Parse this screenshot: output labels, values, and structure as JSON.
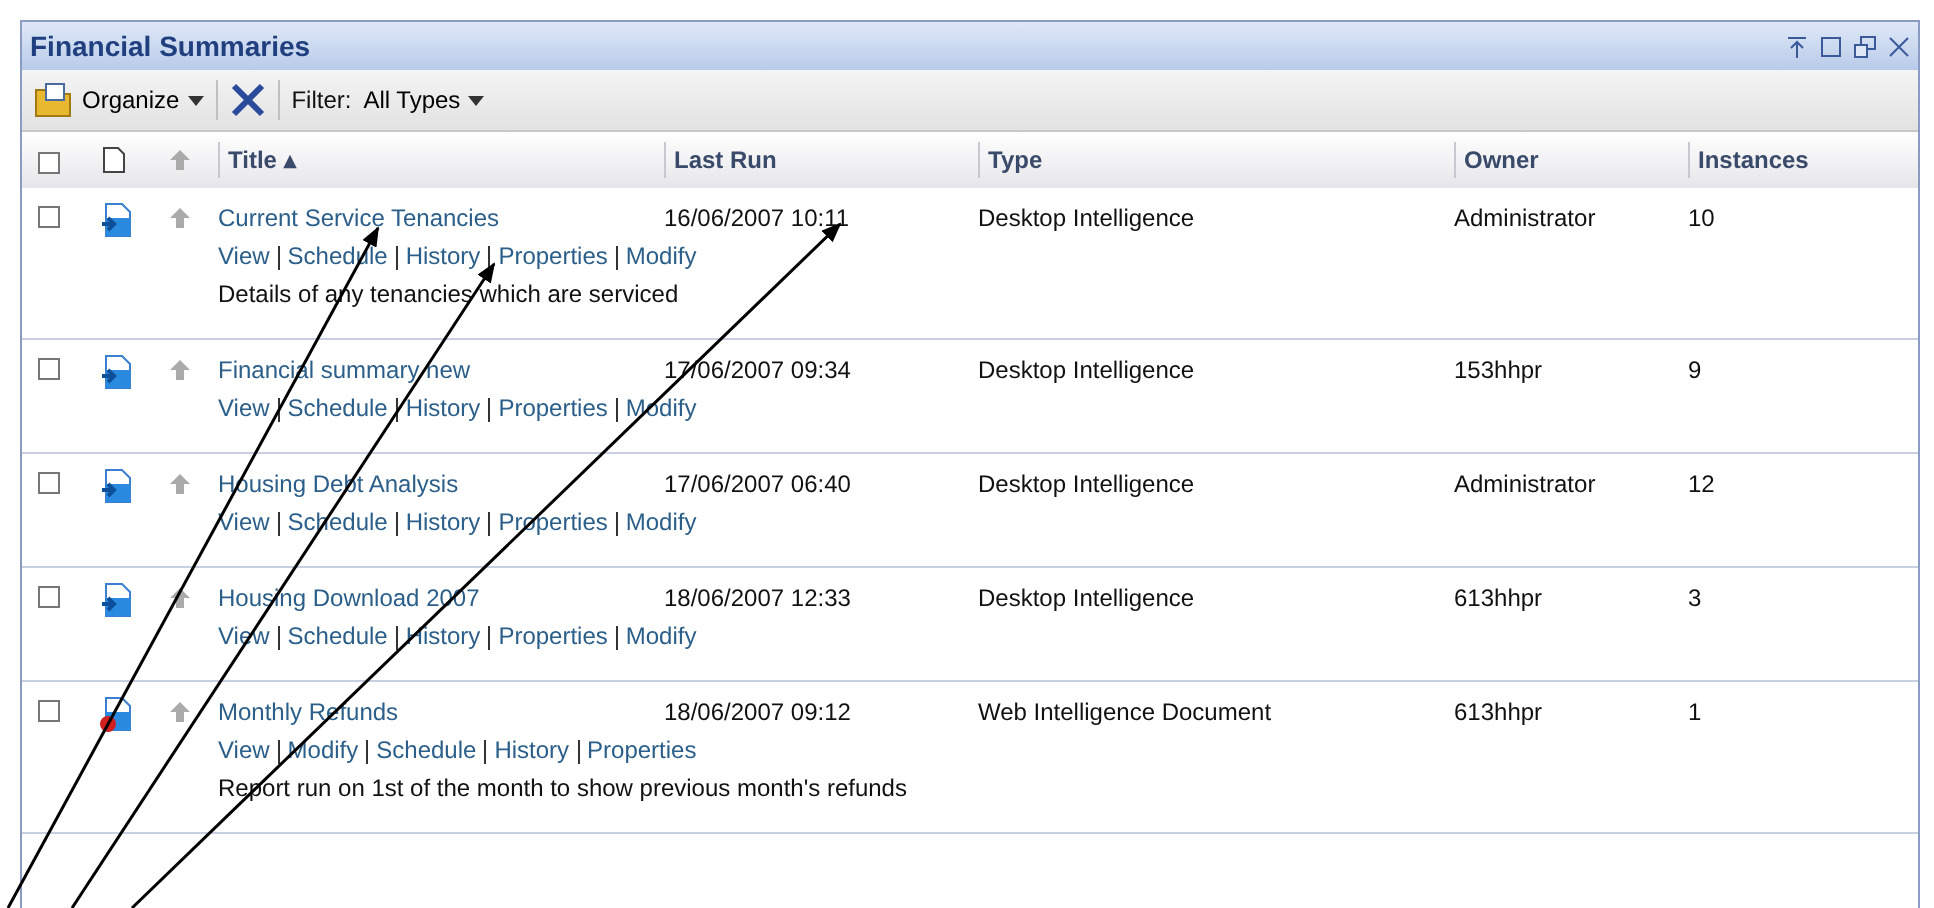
{
  "window": {
    "title": "Financial Summaries"
  },
  "toolbar": {
    "organize": "Organize",
    "filter_label": "Filter:",
    "filter_value": "All Types"
  },
  "table": {
    "all_checked": false,
    "columns": [
      "Title ▴",
      "Last Run",
      "Type",
      "Owner",
      "Instances"
    ],
    "rows": [
      {
        "checked": false,
        "kind": "desktop",
        "title": "Current Service Tenancies",
        "last_run": "16/06/2007 10:11",
        "type": "Desktop Intelligence",
        "owner": "Administrator",
        "instances": "10",
        "actions": [
          "View",
          "Schedule",
          "History",
          "Properties",
          "Modify"
        ],
        "description": "Details of any tenancies which are serviced"
      },
      {
        "checked": false,
        "kind": "desktop",
        "title": "Financial summary new",
        "last_run": "17/06/2007 09:34",
        "type": "Desktop Intelligence",
        "owner": "153hhpr",
        "instances": "9",
        "actions": [
          "View",
          "Schedule",
          "History",
          "Properties",
          "Modify"
        ]
      },
      {
        "checked": false,
        "kind": "desktop",
        "title": "Housing Debt Analysis",
        "last_run": "17/06/2007 06:40",
        "type": "Desktop Intelligence",
        "owner": "Administrator",
        "instances": "12",
        "actions": [
          "View",
          "Schedule",
          "History",
          "Properties",
          "Modify"
        ]
      },
      {
        "checked": false,
        "kind": "desktop",
        "title": "Housing Download 2007",
        "last_run": "18/06/2007 12:33",
        "type": "Desktop Intelligence",
        "owner": "613hhpr",
        "instances": "3",
        "actions": [
          "View",
          "Schedule",
          "History",
          "Properties",
          "Modify"
        ]
      },
      {
        "checked": false,
        "kind": "web",
        "title": "Monthly Refunds",
        "last_run": "18/06/2007 09:12",
        "type": "Web Intelligence Document",
        "owner": "613hhpr",
        "instances": "1",
        "actions": [
          "View",
          "Modify",
          "Schedule",
          "History",
          "Properties"
        ],
        "description": "Report run on 1st of the month to show previous month's refunds"
      }
    ]
  }
}
